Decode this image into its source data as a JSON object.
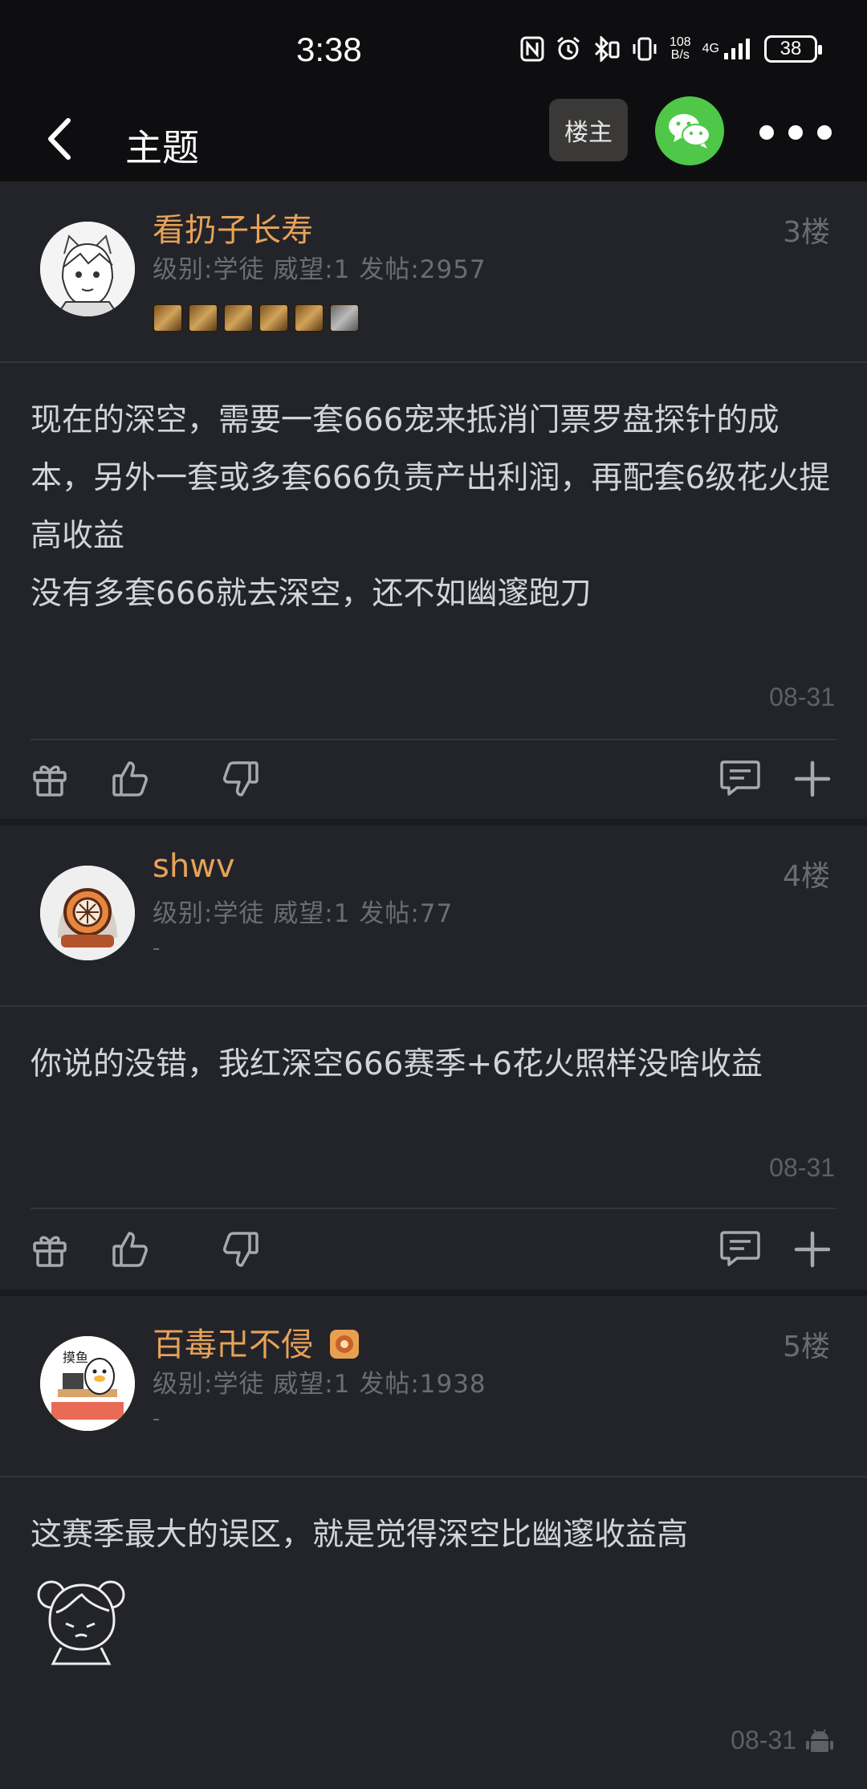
{
  "status": {
    "time": "3:38",
    "net_speed_top": "108",
    "net_speed_bottom": "B/s",
    "network": "4G",
    "battery": "38"
  },
  "header": {
    "title": "主题",
    "op_button": "楼主"
  },
  "posts": [
    {
      "username": "看扔子长寿",
      "meta": "级别:学徒 威望:1 发帖:2957",
      "floor": "3楼",
      "content": "现在的深空，需要一套666宠来抵消门票罗盘探针的成本，另外一套或多套666负责产出利润，再配套6级花火提高收益\n没有多套666就去深空，还不如幽邃跑刀",
      "date": "08-31"
    },
    {
      "username": "shwv",
      "meta": "级别:学徒 威望:1 发帖:77",
      "floor": "4楼",
      "signature": "-",
      "content": "你说的没错，我红深空666赛季+6花火照样没啥收益",
      "date": "08-31"
    },
    {
      "username": "百毒卍不侵",
      "meta": "级别:学徒 威望:1 发帖:1938",
      "floor": "5楼",
      "signature": "-",
      "content": "这赛季最大的误区，就是觉得深空比幽邃收益高",
      "date": "08-31"
    }
  ],
  "colors": {
    "background": "#23242a",
    "topbar": "#0e0e10",
    "username": "#e8a258",
    "wechat": "#4fc849",
    "muted": "#6b6d74"
  }
}
